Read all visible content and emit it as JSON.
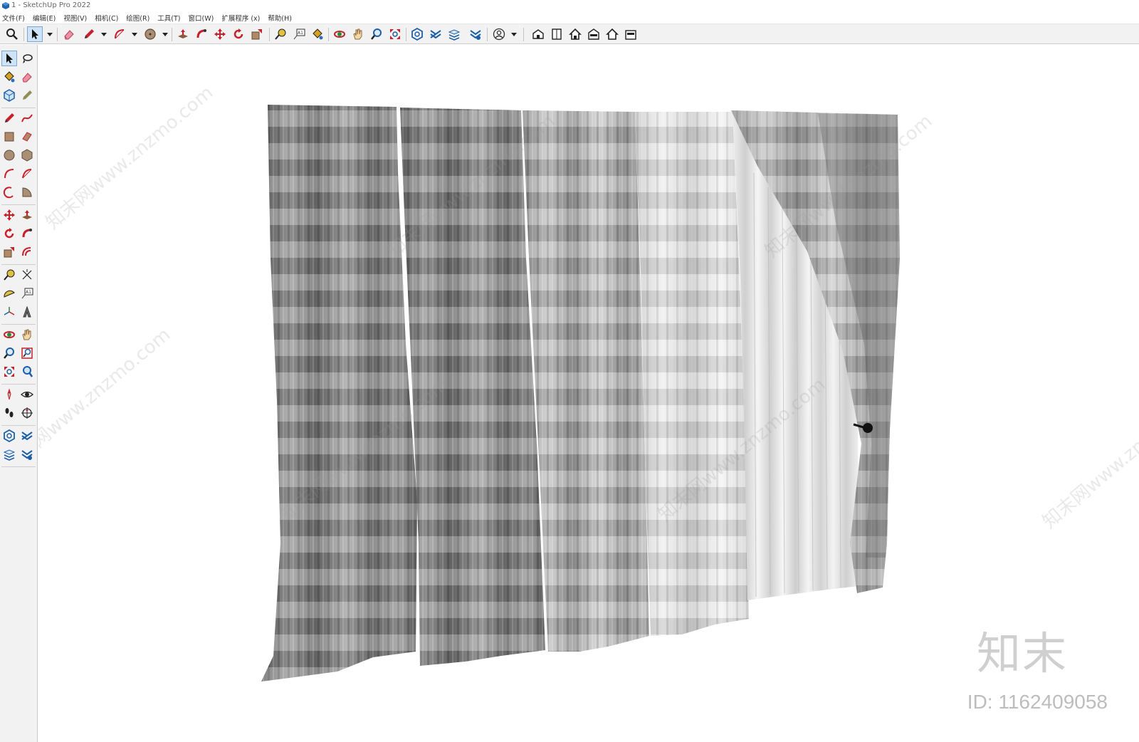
{
  "window": {
    "title": "1 - SketchUp Pro 2022"
  },
  "menu": {
    "items": [
      "文件(F)",
      "编辑(E)",
      "视图(V)",
      "相机(C)",
      "绘图(R)",
      "工具(T)",
      "窗口(W)",
      "扩展程序 (x)",
      "帮助(H)"
    ]
  },
  "toolbar": {
    "selected_tool": "select-tool",
    "tools": [
      "search-icon",
      "select-icon",
      "eraser-icon",
      "pencil-icon",
      "arc-icon",
      "circle-icon",
      "push-pull-icon",
      "follow-me-icon",
      "move-icon",
      "rotate-icon",
      "scale-icon",
      "tape-measure-icon",
      "text-icon",
      "paint-bucket-icon",
      "orbit-icon",
      "pan-icon",
      "zoom-icon",
      "zoom-extents-icon",
      "3d-warehouse-icon",
      "extension-warehouse-icon",
      "layout-icon",
      "extension-manager-icon",
      "account-icon",
      "house-iso-icon",
      "house-front-icon",
      "house-right-icon",
      "house-back-icon",
      "house-left-icon",
      "house-top-icon"
    ]
  },
  "palette": {
    "selected_tool": "select-tool"
  },
  "brand": {
    "logo": "知末",
    "id_text": "ID: 1162409058"
  },
  "watermark": {
    "text": "知末网www.znzmo.com"
  },
  "colors": {
    "toolbar_bg": "#f2f2f2",
    "selection_highlight": "#cfe3f7",
    "tool_red": "#c8202b",
    "tool_blue": "#1c5fa8",
    "curtain_dark": "#7b7b7b",
    "curtain_light": "#e4e4e4"
  }
}
